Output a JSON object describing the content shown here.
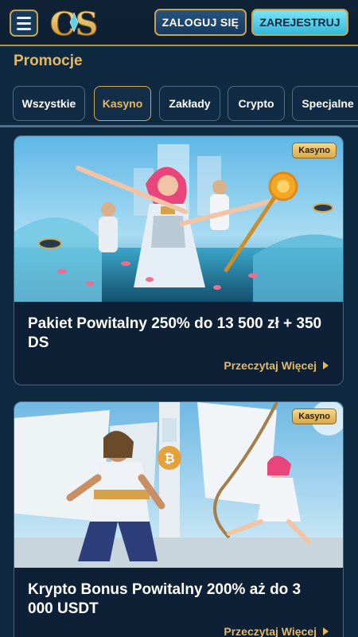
{
  "header": {
    "logo_text": "CS",
    "login_label": "ZALOGUJ SIĘ",
    "register_label": "ZAREJESTRUJ"
  },
  "page": {
    "title": "Promocje"
  },
  "tabs": [
    {
      "label": "Wszystkie",
      "active": false
    },
    {
      "label": "Kasyno",
      "active": true
    },
    {
      "label": "Zakłady",
      "active": false
    },
    {
      "label": "Crypto",
      "active": false
    },
    {
      "label": "Specjalne",
      "active": false
    }
  ],
  "promotions": [
    {
      "badge": "Kasyno",
      "title": "Pakiet Powitalny 250% do 13 500 zł + 350 DS",
      "link_label": "Przeczytaj Więcej"
    },
    {
      "badge": "Kasyno",
      "title": "Krypto Bonus Powitalny 200% aż do 3 000 USDT",
      "link_label": "Przeczytaj Więcej"
    }
  ],
  "colors": {
    "background": "#0f2a40",
    "gold": "#e2b964",
    "register_button": "#4cc6e3"
  }
}
